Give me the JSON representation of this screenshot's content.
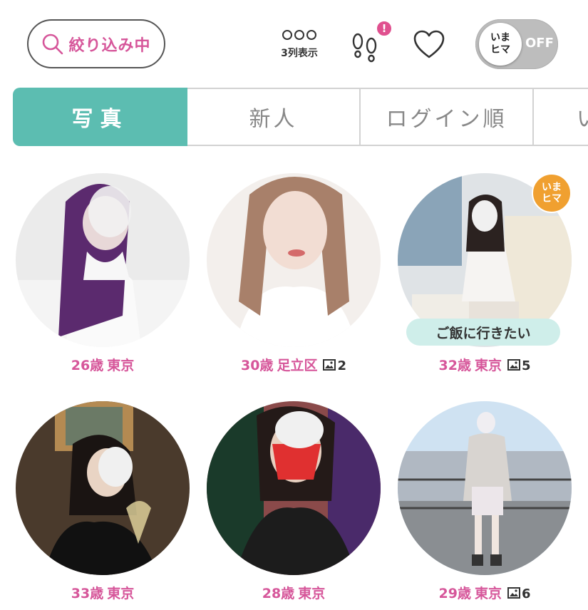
{
  "header": {
    "filter_label": "絞り込み中",
    "layout_label": "3列表示",
    "notification_badge": "!",
    "toggle": {
      "label": "いま\nヒマ",
      "state": "OFF"
    }
  },
  "tabs": [
    {
      "label": "写真",
      "active": true
    },
    {
      "label": "新人",
      "active": false
    },
    {
      "label": "ログイン順",
      "active": false
    },
    {
      "label": "い",
      "active": false
    }
  ],
  "profiles": [
    {
      "age": "26歳",
      "city": "東京",
      "photo_count": ""
    },
    {
      "age": "30歳",
      "city": "足立区",
      "photo_count": "2"
    },
    {
      "age": "32歳",
      "city": "東京",
      "photo_count": "5",
      "status_badge": "いま\nヒマ",
      "message": "ご飯に行きたい"
    },
    {
      "age": "33歳",
      "city": "東京",
      "photo_count": ""
    },
    {
      "age": "28歳",
      "city": "東京",
      "photo_count": ""
    },
    {
      "age": "29歳",
      "city": "東京",
      "photo_count": "6"
    }
  ],
  "colors": {
    "accent_pink": "#d6569a",
    "tab_active": "#5cbdb1",
    "badge_orange": "#f0a030",
    "message_bg": "#cfeeea"
  }
}
